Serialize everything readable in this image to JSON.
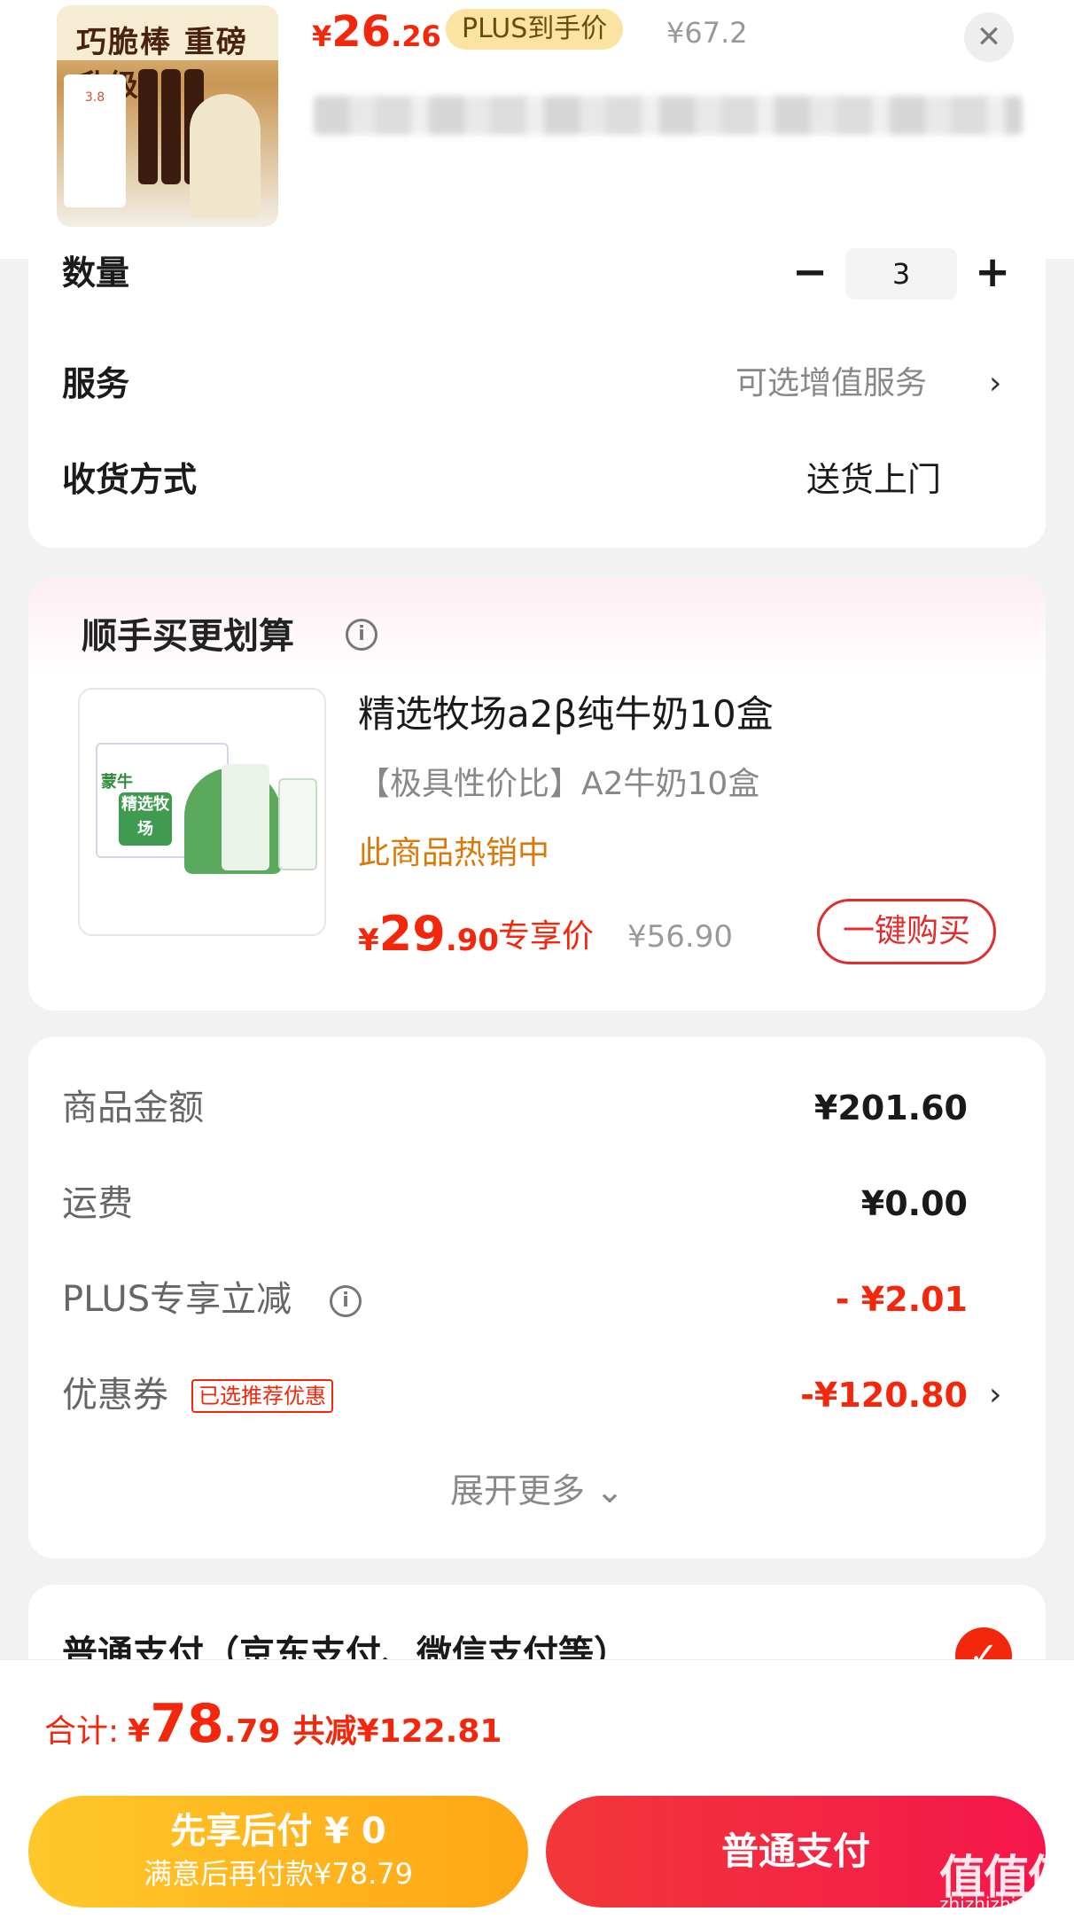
{
  "header": {
    "image_alt": "巧脆棒 重磅升级",
    "price_symbol": "¥",
    "price_int": "26",
    "price_dec": ".26",
    "plus_tag": "PLUS到手价",
    "original_price": "¥67.2",
    "close_icon": "close-icon"
  },
  "info": {
    "quantity_label": "数量",
    "quantity_minus": "−",
    "quantity_value": "3",
    "quantity_plus": "+",
    "service_label": "服务",
    "service_value": "可选增值服务",
    "service_arrow": "›",
    "shipping_label": "收货方式",
    "shipping_value": "送货上门"
  },
  "recommend": {
    "title": "顺手买更划算",
    "info_icon": "i",
    "product_name": "精选牧场a2β纯牛奶10盒",
    "product_desc": "【极具性价比】A2牛奶10盒",
    "hot_text": "此商品热销中",
    "price_symbol": "¥",
    "price_int": "29",
    "price_dec": ".90",
    "exclusive_label": "专享价",
    "original_price": "¥56.90",
    "buy_button": "一键购买",
    "image_brand": "蒙牛",
    "image_label": "精选牧场"
  },
  "amounts": {
    "goods_label": "商品金额",
    "goods_value": "¥201.60",
    "freight_label": "运费",
    "freight_value": "¥0.00",
    "plus_label": "PLUS专享立减",
    "plus_info_icon": "i",
    "plus_value": "- ¥2.01",
    "coupon_label": "优惠券",
    "coupon_tag": "已选推荐优惠",
    "coupon_value": "-¥120.80",
    "coupon_arrow": "›",
    "expand_more": "展开更多 ⌄"
  },
  "payment": {
    "option_label": "普通支付（京东支付、微信支付等）",
    "check_icon": "✓"
  },
  "footer": {
    "total_label": "合计:",
    "total_symbol": "¥",
    "total_int": "78",
    "total_dec": ".79",
    "total_saving": "共减¥122.81",
    "pay_later_title": "先享后付 ¥ 0",
    "pay_later_sub": "满意后再付款¥78.79",
    "pay_button": "普通支付",
    "watermark": "值值值",
    "watermark_sub": "zhizhizhi.com"
  },
  "colors": {
    "accent_red": "#f2270c",
    "hot_orange": "#d9790a",
    "plus_gold": "#fbe3a1",
    "pay_later_yellow": "#ffb21f"
  }
}
